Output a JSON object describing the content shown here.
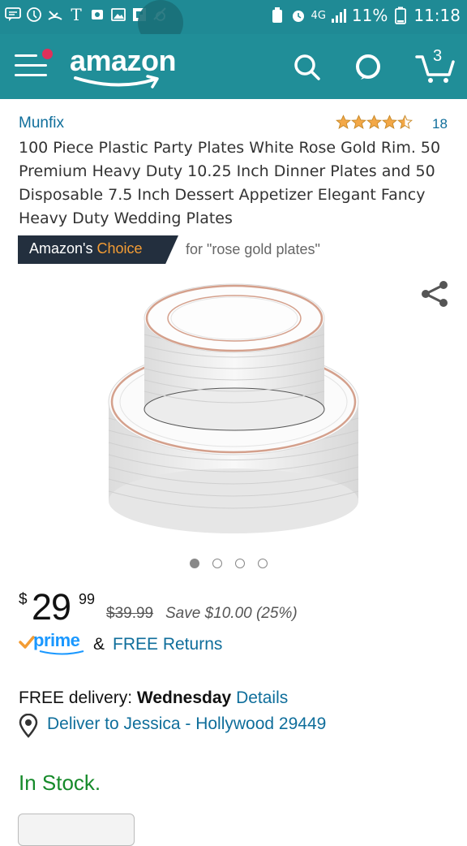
{
  "status_bar": {
    "battery": "11%",
    "time": "11:18",
    "network": "4G"
  },
  "header": {
    "logo_text": "amazon",
    "cart_count": "3"
  },
  "product": {
    "brand": "Munfix",
    "rating_stars": 4.5,
    "rating_count": "18",
    "title": "100 Piece Plastic Party Plates White Rose Gold Rim. 50 Premium Heavy Duty 10.25 Inch Dinner Plates and 50 Disposable 7.5 Inch Dessert Appetizer Elegant Fancy Heavy Duty Wedding Plates",
    "badge_prefix": "Amazon's",
    "badge_word": "Choice",
    "badge_for": "for \"rose gold plates\"",
    "image_count": 4,
    "image_active": 1
  },
  "pricing": {
    "currency": "$",
    "whole": "29",
    "fraction": "99",
    "was": "$39.99",
    "save": "Save $10.00 (25%)"
  },
  "prime": {
    "label": "prime",
    "amp": "&",
    "returns": "FREE Returns"
  },
  "delivery": {
    "prefix": "FREE delivery:",
    "day": "Wednesday",
    "details": "Details",
    "deliver_to": "Deliver to Jessica - Hollywood 29449"
  },
  "stock": {
    "status": "In Stock."
  },
  "colors": {
    "header_bg": "#208e98",
    "link": "#0f6e9b",
    "in_stock": "#168a2a",
    "badge_bg": "#232f3e",
    "badge_accent": "#f39c34",
    "prime_blue": "#1a98ff"
  }
}
